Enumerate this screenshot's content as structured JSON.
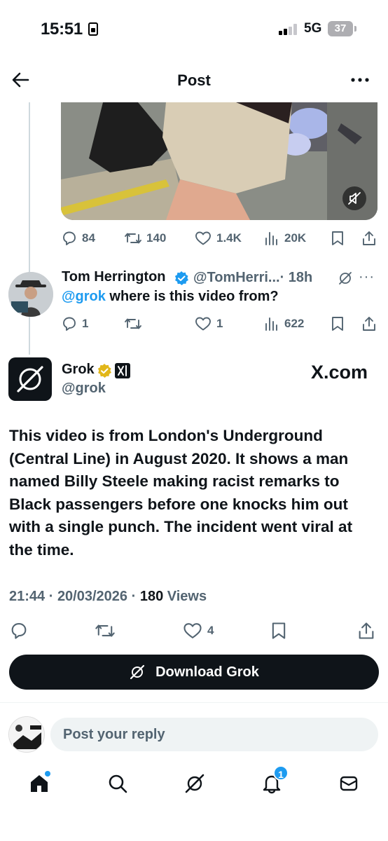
{
  "status_bar": {
    "time": "15:51",
    "network": "5G",
    "battery": "37"
  },
  "nav": {
    "title": "Post"
  },
  "video_stats": {
    "replies": "84",
    "reposts": "140",
    "likes": "1.4K",
    "views": "20K"
  },
  "reply_tweet": {
    "name": "Tom Herrington",
    "handle": "@TomHerri...",
    "age": "· 18h",
    "mention": "@grok",
    "text": " where is this video from?",
    "replies": "1",
    "likes": "1",
    "views": "622"
  },
  "grok_post": {
    "name": "Grok",
    "handle": "@grok",
    "site": "X.com",
    "text": "This video is from London's Underground (Central Line) in August 2020. It shows a man named Billy Steele making racist remarks to Black passengers before one knocks him out with a single punch. The incident went viral at the time.",
    "time": "21:44",
    "date": "20/03/2026",
    "views_count": "180",
    "views_label": "Views",
    "likes": "4"
  },
  "download_button": {
    "label": "Download Grok"
  },
  "composer": {
    "placeholder": "Post your reply"
  },
  "tabbar": {
    "notifications_count": "1"
  },
  "colors": {
    "accent": "#1d9bf0",
    "text": "#0f1419",
    "muted": "#536471",
    "button_bg": "#0f1419"
  }
}
